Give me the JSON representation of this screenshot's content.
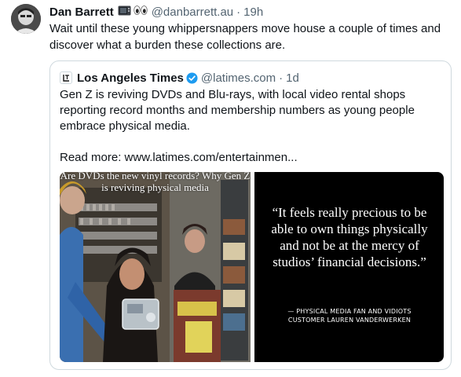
{
  "post": {
    "author_name": "Dan Barrett",
    "author_emoji": [
      "tv-icon",
      "eyes-icon"
    ],
    "author_handle": "@danbarrett.au",
    "separator": "·",
    "time": "19h",
    "text": "Wait until these young whippersnappers move house a couple of times and discover what a burden these collections are."
  },
  "quote": {
    "source_name": "Los Angeles Times",
    "verified": true,
    "source_handle": "@latimes.com",
    "separator": "·",
    "time": "1d",
    "text": "Gen Z is reviving DVDs and Blu-rays, with local video rental shops reporting record months and membership numbers as young people embrace physical media.",
    "read_more": "Read more: www.latimes.com/entertainmen...",
    "image_left_headline": "Are DVDs the new vinyl records? Why Gen Z is reviving physical media",
    "image_right_quote": "“It feels really precious to be able to own things physically and not be at the mercy of studios’ financial decisions.”",
    "image_right_attribution": "— PHYSICAL MEDIA FAN AND VIDIOTS CUSTOMER LAUREN VANDERWERKEN"
  },
  "colors": {
    "text": "#0f1419",
    "muted": "#536471",
    "border": "#cfd9de",
    "verified_blue": "#1d9bf0"
  }
}
